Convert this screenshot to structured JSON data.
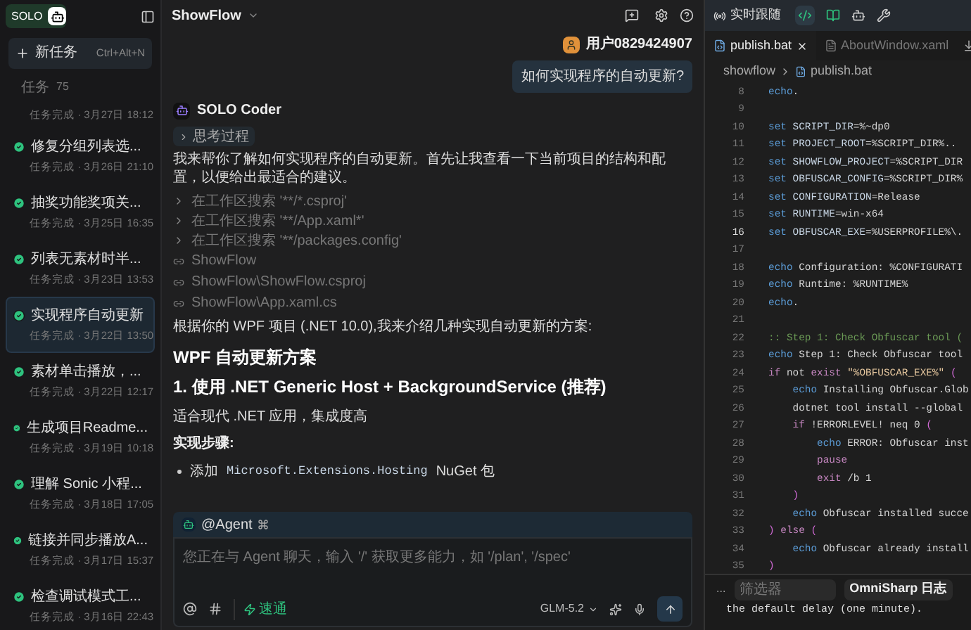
{
  "sidebar": {
    "logo": "SOLO",
    "new_task": {
      "label": "新任务",
      "shortcut": "Ctrl+Alt+N"
    },
    "section": {
      "label": "任务",
      "count": "75"
    },
    "items": [
      {
        "meta": "任务完成 · 3月27日 18:12",
        "selected": false
      },
      {
        "title": "修复分组列表选...",
        "meta": "任务完成 · 3月26日 21:10",
        "selected": false
      },
      {
        "title": "抽奖功能奖项关...",
        "meta": "任务完成 · 3月25日 16:35",
        "selected": false
      },
      {
        "title": "列表无素材时半...",
        "meta": "任务完成 · 3月23日 13:53",
        "selected": false
      },
      {
        "title": "实现程序自动更新",
        "meta": "任务完成 · 3月22日 13:50",
        "selected": true
      },
      {
        "title": "素材单击播放，...",
        "meta": "任务完成 · 3月22日 12:17",
        "selected": false
      },
      {
        "title": "生成项目Readme...",
        "meta": "任务完成 · 3月19日 10:18",
        "selected": false
      },
      {
        "title": "理解 Sonic 小程...",
        "meta": "任务完成 · 3月18日 17:05",
        "selected": false
      },
      {
        "title": "链接并同步播放A...",
        "meta": "任务完成 · 3月17日 15:37",
        "selected": false
      },
      {
        "title": "检查调试模式工...",
        "meta": "任务完成 · 3月16日 22:43",
        "selected": false
      }
    ]
  },
  "chat": {
    "project": "ShowFlow",
    "user": {
      "name": "用户0829424907",
      "message": "如何实现程序的自动更新?"
    },
    "bot": {
      "name": "SOLO Coder",
      "thinking": "思考过程"
    },
    "blocks": [
      {
        "kind": "p",
        "text": "我来帮你了解如何实现程序的自动更新。首先让我查看一下当前项目的结构和配置，以便给出最适合的建议。"
      },
      {
        "kind": "search",
        "text": "在工作区搜索 '**/*.csproj'"
      },
      {
        "kind": "search",
        "text": "在工作区搜索 '**/App.xaml*'"
      },
      {
        "kind": "search",
        "text": "在工作区搜索 '**/packages.config'"
      },
      {
        "kind": "file",
        "text": "ShowFlow"
      },
      {
        "kind": "file",
        "text": "ShowFlow\\ShowFlow.csproj"
      },
      {
        "kind": "file",
        "text": "ShowFlow\\App.xaml.cs"
      },
      {
        "kind": "p",
        "text": "根据你的 WPF 项目 (.NET 10.0),我来介绍几种实现自动更新的方案:"
      },
      {
        "kind": "h2",
        "text": "WPF 自动更新方案"
      },
      {
        "kind": "h3",
        "text": "1. 使用 .NET Generic Host + BackgroundService (推荐)"
      },
      {
        "kind": "p",
        "text": "适合现代 .NET 应用，集成度高"
      },
      {
        "kind": "bold",
        "text": "实现步骤:"
      },
      {
        "kind": "bullet",
        "before": "添加",
        "code": "Microsoft.Extensions.Hosting",
        "after": "NuGet 包"
      }
    ],
    "composer": {
      "agent": "@Agent",
      "placeholder": "您正在与 Agent 聊天，输入 '/' 获取更多能力，如 '/plan', '/spec'",
      "mode": "速通",
      "model": "GLM-5.2"
    }
  },
  "right": {
    "follow": "实时跟随",
    "tabs": [
      {
        "label": "publish.bat",
        "selected": true
      },
      {
        "label": "AboutWindow.xaml",
        "selected": false
      }
    ],
    "breadcrumb": [
      "showflow",
      "publish.bat"
    ],
    "code": [
      {
        "no": "8",
        "tokens": [
          {
            "t": "echo",
            "kind": "kw"
          },
          {
            "t": ".",
            "kind": "plain"
          }
        ]
      },
      {
        "no": "9"
      },
      {
        "no": "10",
        "tokens": [
          {
            "t": "set ",
            "kind": "kw"
          },
          {
            "t": "SCRIPT_DIR",
            "kind": "var"
          },
          {
            "t": "=%~dp0",
            "kind": "plain"
          }
        ]
      },
      {
        "no": "11",
        "tokens": [
          {
            "t": "set ",
            "kind": "kw"
          },
          {
            "t": "PROJECT_ROOT",
            "kind": "var"
          },
          {
            "t": "=%SCRIPT_DIR%..",
            "kind": "plain"
          }
        ]
      },
      {
        "no": "12",
        "tokens": [
          {
            "t": "set ",
            "kind": "kw"
          },
          {
            "t": "SHOWFLOW_PROJECT",
            "kind": "var"
          },
          {
            "t": "=%SCRIPT_DIR",
            "kind": "plain"
          }
        ]
      },
      {
        "no": "13",
        "tokens": [
          {
            "t": "set ",
            "kind": "kw"
          },
          {
            "t": "OBFUSCAR_CONFIG",
            "kind": "var"
          },
          {
            "t": "=%SCRIPT_DIR%",
            "kind": "plain"
          }
        ]
      },
      {
        "no": "14",
        "tokens": [
          {
            "t": "set ",
            "kind": "kw"
          },
          {
            "t": "CONFIGURATION",
            "kind": "var"
          },
          {
            "t": "=Release",
            "kind": "plain"
          }
        ]
      },
      {
        "no": "15",
        "tokens": [
          {
            "t": "set ",
            "kind": "kw"
          },
          {
            "t": "RUNTIME",
            "kind": "var"
          },
          {
            "t": "=win-x64",
            "kind": "plain"
          }
        ]
      },
      {
        "no": "16",
        "tokens": [
          {
            "t": "set ",
            "kind": "kw"
          },
          {
            "t": "OBFUSCAR_EXE",
            "kind": "var"
          },
          {
            "t": "=%USERPROFILE%\\.",
            "kind": "plain"
          }
        ]
      },
      {
        "no": "17"
      },
      {
        "no": "18",
        "tokens": [
          {
            "t": "echo",
            "kind": "kw"
          },
          {
            "t": " Configuration: %CONFIGURATI",
            "kind": "plain"
          }
        ]
      },
      {
        "no": "19",
        "tokens": [
          {
            "t": "echo",
            "kind": "kw"
          },
          {
            "t": " Runtime: %RUNTIME%",
            "kind": "plain"
          }
        ]
      },
      {
        "no": "20",
        "tokens": [
          {
            "t": "echo",
            "kind": "kw"
          },
          {
            "t": ".",
            "kind": "plain"
          }
        ]
      },
      {
        "no": "21"
      },
      {
        "no": "22",
        "tokens": [
          {
            "t": ":: Step 1: Check Obfuscar tool (",
            "kind": "comment"
          }
        ]
      },
      {
        "no": "23",
        "tokens": [
          {
            "t": "echo",
            "kind": "kw"
          },
          {
            "t": " Step 1: Check Obfuscar tool",
            "kind": "plain"
          }
        ]
      },
      {
        "no": "24",
        "tokens": [
          {
            "t": "if",
            "kind": "ctrl"
          },
          {
            "t": " not ",
            "kind": "plain"
          },
          {
            "t": "exist",
            "kind": "ctrl"
          },
          {
            "t": " \"%OBFUSCAR_EXE%\"",
            "kind": "str"
          },
          {
            "t": " (",
            "kind": "paren"
          }
        ]
      },
      {
        "no": "25",
        "tokens": [
          {
            "t": "    echo",
            "kind": "kw"
          },
          {
            "t": " Installing Obfuscar.Glob",
            "kind": "plain"
          }
        ]
      },
      {
        "no": "26",
        "tokens": [
          {
            "t": "    dotnet tool install --global",
            "kind": "plain"
          }
        ]
      },
      {
        "no": "27",
        "tokens": [
          {
            "t": "    if",
            "kind": "ctrl"
          },
          {
            "t": " !ERRORLEVEL! neq 0 ",
            "kind": "plain"
          },
          {
            "t": "(",
            "kind": "paren"
          }
        ]
      },
      {
        "no": "28",
        "tokens": [
          {
            "t": "        echo",
            "kind": "kw"
          },
          {
            "t": " ERROR: Obfuscar inst",
            "kind": "plain"
          }
        ]
      },
      {
        "no": "29",
        "tokens": [
          {
            "t": "        pause",
            "kind": "ctrl"
          }
        ]
      },
      {
        "no": "30",
        "tokens": [
          {
            "t": "        exit",
            "kind": "ctrl"
          },
          {
            "t": " /b 1",
            "kind": "plain"
          }
        ]
      },
      {
        "no": "31",
        "tokens": [
          {
            "t": "    )",
            "kind": "paren"
          }
        ]
      },
      {
        "no": "32",
        "tokens": [
          {
            "t": "    echo",
            "kind": "kw"
          },
          {
            "t": " Obfuscar installed succe",
            "kind": "plain"
          }
        ]
      },
      {
        "no": "33",
        "tokens": [
          {
            "t": ")",
            "kind": "paren"
          },
          {
            "t": " else ",
            "kind": "ctrl"
          },
          {
            "t": "(",
            "kind": "paren"
          }
        ]
      },
      {
        "no": "34",
        "tokens": [
          {
            "t": "    echo",
            "kind": "kw"
          },
          {
            "t": " Obfuscar already install",
            "kind": "plain"
          }
        ]
      },
      {
        "no": "35",
        "tokens": [
          {
            "t": ")",
            "kind": "paren"
          }
        ]
      }
    ],
    "panel": {
      "more": "...",
      "filter_placeholder": "筛选器",
      "channel": "OmniSharp 日志",
      "log": "the default delay (one minute)."
    }
  }
}
